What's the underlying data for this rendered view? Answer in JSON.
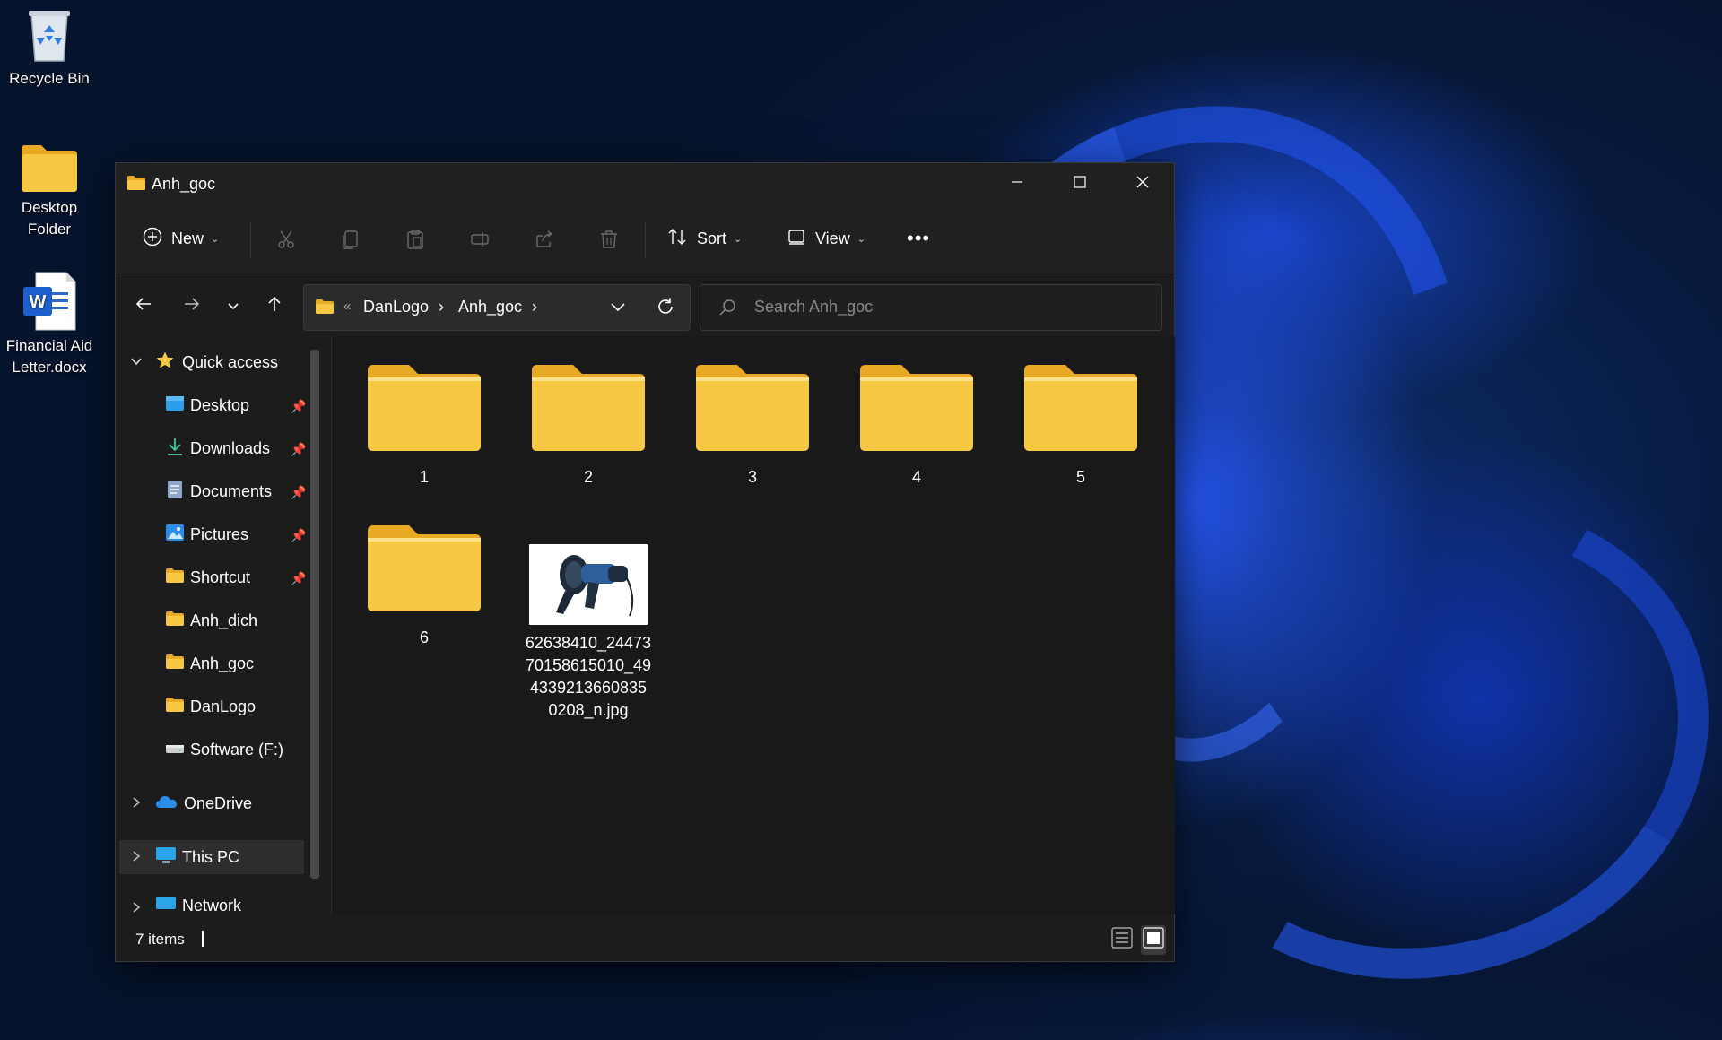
{
  "desktop": {
    "icons": [
      {
        "label_line1": "Recycle Bin",
        "label_line2": "",
        "icon": "recycle-bin-icon"
      },
      {
        "label_line1": "Desktop",
        "label_line2": "Folder",
        "icon": "folder-icon"
      },
      {
        "label_line1": "Financial Aid",
        "label_line2": "Letter.docx",
        "icon": "word-document-icon"
      }
    ]
  },
  "window": {
    "title": "Anh_goc",
    "controls": {
      "minimize": "minimize-icon",
      "maximize": "maximize-icon",
      "close": "close-icon"
    }
  },
  "toolbar": {
    "new_label": "New",
    "sort_label": "Sort",
    "view_label": "View",
    "more_label": "•••",
    "action_icons": [
      "cut-icon",
      "copy-icon",
      "paste-icon",
      "rename-icon",
      "share-icon",
      "delete-icon"
    ]
  },
  "navigation": {
    "breadcrumbs": [
      "DanLogo",
      "Anh_goc"
    ],
    "overflow": "«",
    "separator": "›",
    "search_placeholder": "Search Anh_goc"
  },
  "sidebar": {
    "quick_access": "Quick access",
    "items": [
      {
        "label": "Desktop",
        "icon": "desktop-icon",
        "pinned": true
      },
      {
        "label": "Downloads",
        "icon": "download-icon",
        "pinned": true
      },
      {
        "label": "Documents",
        "icon": "documents-icon",
        "pinned": true
      },
      {
        "label": "Pictures",
        "icon": "pictures-icon",
        "pinned": true
      },
      {
        "label": "Shortcut",
        "icon": "folder-icon",
        "pinned": true
      },
      {
        "label": "Anh_dich",
        "icon": "folder-icon",
        "pinned": false
      },
      {
        "label": "Anh_goc",
        "icon": "folder-icon",
        "pinned": false
      },
      {
        "label": "DanLogo",
        "icon": "folder-icon",
        "pinned": false
      },
      {
        "label": "Software (F:)",
        "icon": "drive-icon",
        "pinned": false
      }
    ],
    "onedrive": "OneDrive",
    "this_pc": "This PC",
    "network": "Network"
  },
  "content": {
    "items": [
      {
        "name": "1",
        "type": "folder"
      },
      {
        "name": "2",
        "type": "folder"
      },
      {
        "name": "3",
        "type": "folder"
      },
      {
        "name": "4",
        "type": "folder"
      },
      {
        "name": "5",
        "type": "folder"
      },
      {
        "name": "6",
        "type": "folder"
      },
      {
        "name_lines": [
          "62638410_24473",
          "70158615010_49",
          "4339213660835",
          "0208_n.jpg"
        ],
        "type": "image"
      }
    ]
  },
  "status": {
    "count": "7 items",
    "view_icons": [
      "details-view-icon",
      "large-icons-view-icon"
    ]
  },
  "colors": {
    "folder": "#f6c843",
    "folder_dark": "#e8a924",
    "accent": "#3f7bf2",
    "window_bg": "#202020"
  }
}
